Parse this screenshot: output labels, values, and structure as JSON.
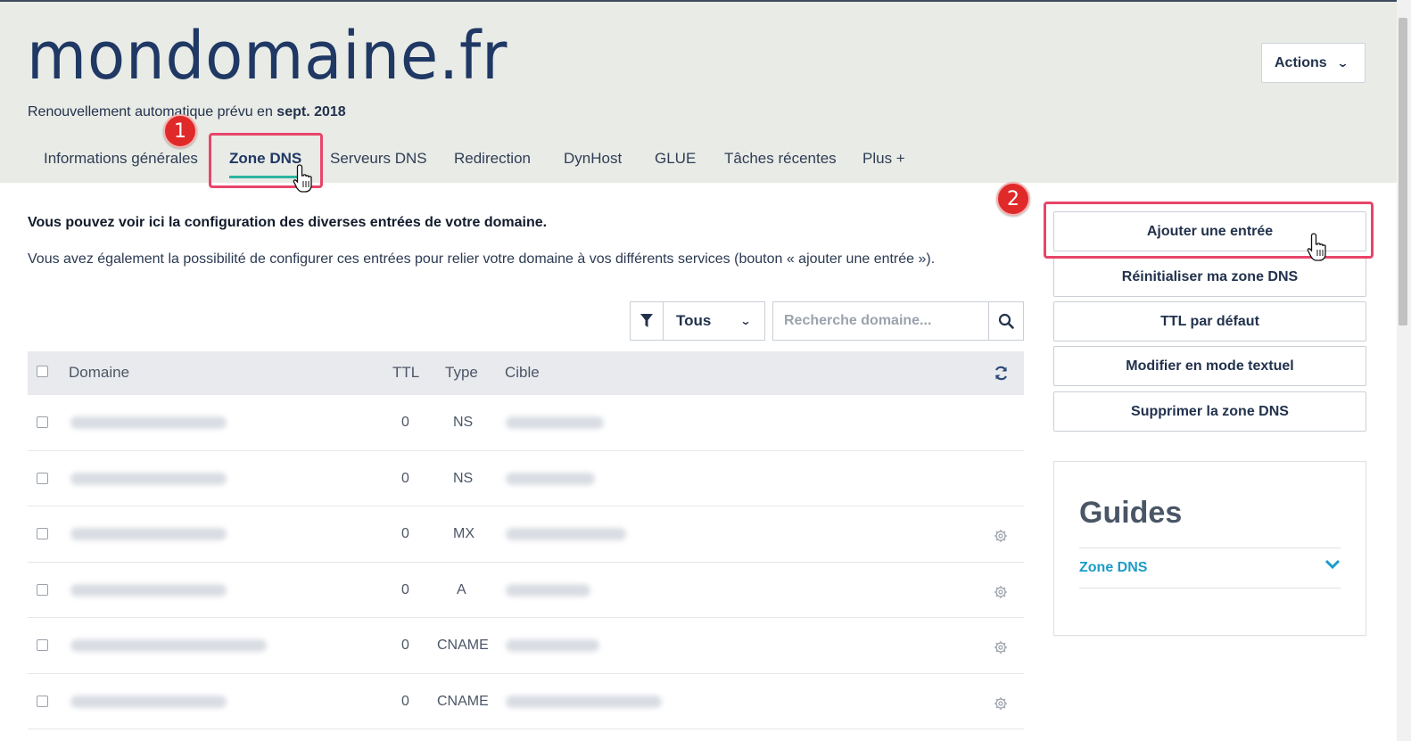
{
  "header": {
    "domain": "mondomaine.fr",
    "renewal_prefix": "Renouvellement automatique prévu en ",
    "renewal_date": "sept. 2018",
    "actions_label": "Actions"
  },
  "tabs": [
    {
      "label": "Informations générales",
      "active": false
    },
    {
      "label": "Zone DNS",
      "active": true
    },
    {
      "label": "Serveurs DNS",
      "active": false
    },
    {
      "label": "Redirection",
      "active": false
    },
    {
      "label": "DynHost",
      "active": false
    },
    {
      "label": "GLUE",
      "active": false
    },
    {
      "label": "Tâches récentes",
      "active": false
    },
    {
      "label": "Plus +",
      "active": false
    }
  ],
  "steps": [
    "1",
    "2"
  ],
  "intro": {
    "bold": "Vous pouvez voir ici la configuration des diverses entrées de votre domaine.",
    "text": "Vous avez également la possibilité de configurer ces entrées pour relier votre domaine à vos différents services (bouton « ajouter une entrée »)."
  },
  "filter": {
    "selected": "Tous",
    "search_placeholder": "Recherche domaine..."
  },
  "table": {
    "headers": {
      "domain": "Domaine",
      "ttl": "TTL",
      "type": "Type",
      "target": "Cible"
    },
    "rows": [
      {
        "ttl": "0",
        "type": "NS"
      },
      {
        "ttl": "0",
        "type": "NS"
      },
      {
        "ttl": "0",
        "type": "MX"
      },
      {
        "ttl": "0",
        "type": "A"
      },
      {
        "ttl": "0",
        "type": "CNAME"
      },
      {
        "ttl": "0",
        "type": "CNAME"
      }
    ]
  },
  "sidebar": {
    "buttons": [
      "Ajouter une entrée",
      "Réinitialiser ma zone DNS",
      "TTL par défaut",
      "Modifier en mode textuel",
      "Supprimer la zone DNS"
    ],
    "guides_title": "Guides",
    "guides_link": "Zone DNS"
  },
  "colors": {
    "header_bg": "#e9ebe6",
    "title": "#1f3864",
    "active_tab_underline": "#2cb5a0",
    "highlight": "#e8456a",
    "badge": "#e02a2a",
    "link": "#1c9cc9"
  }
}
